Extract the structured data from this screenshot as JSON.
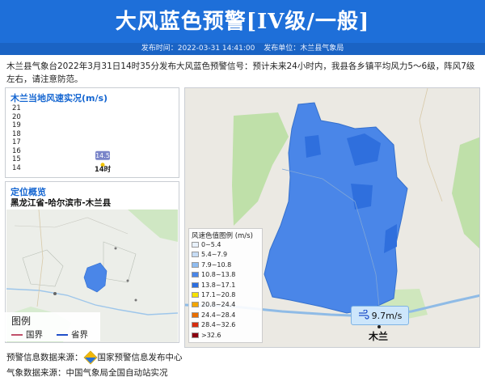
{
  "header": {
    "title": "大风蓝色预警[IV级/一般]",
    "publish_time_label": "发布时间：2022-03-31 14:41:00",
    "publisher_label": "发布单位：木兰县气象局",
    "bg_color": "#1e6fd9"
  },
  "description": "木兰县气象台2022年3月31日14时35分发布大风蓝色预警信号：预计未来24小时内，我县各乡镇平均风力5～6级，阵风7级左右，请注意防范。",
  "wind_panel": {
    "title": "木兰当地风速实况(m/s)",
    "chart_data": {
      "type": "scatter",
      "x": [
        "14时"
      ],
      "y": [
        14.5
      ],
      "y_ticks": [
        21,
        20,
        19,
        18,
        17,
        16,
        15,
        14
      ],
      "ylim": [
        14,
        21
      ],
      "data_labels": [
        "14.5"
      ],
      "point_color": "#f2c400",
      "label_bg": "#7a85c9"
    }
  },
  "location_panel": {
    "title": "定位概览",
    "location": "黑龙江省-哈尔滨市-木兰县"
  },
  "mini_legend": {
    "title": "图例",
    "items": [
      {
        "label": "国界",
        "color": "#c0506a"
      },
      {
        "label": "省界",
        "color": "#1f4fc9"
      }
    ]
  },
  "color_legend": {
    "title": "风速色值图例 (m/s)",
    "items": [
      {
        "label": "0~5.4",
        "color": "#e8f1fb"
      },
      {
        "label": "5.4~7.9",
        "color": "#c6dcf5"
      },
      {
        "label": "7.9~10.8",
        "color": "#8fbcf0"
      },
      {
        "label": "10.8~13.8",
        "color": "#4a86e8"
      },
      {
        "label": "13.8~17.1",
        "color": "#2b6ee0"
      },
      {
        "label": "17.1~20.8",
        "color": "#f6e100"
      },
      {
        "label": "20.8~24.4",
        "color": "#f2a500"
      },
      {
        "label": "24.4~28.4",
        "color": "#e86e00"
      },
      {
        "label": "28.4~32.6",
        "color": "#d62e10"
      },
      {
        "label": ">32.6",
        "color": "#8b0010"
      }
    ]
  },
  "main_map": {
    "wind_badge": "9.7m/s",
    "town_label": "木兰",
    "region_color": "#4a86e8"
  },
  "footer": {
    "warning_source": "预警信息数据来源：",
    "warning_source_name": "国家预警信息发布中心",
    "weather_source": "气象数据来源：中国气象局全国自动站实况"
  }
}
